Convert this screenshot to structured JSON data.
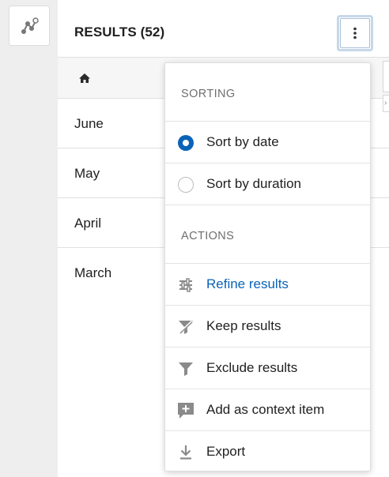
{
  "left_rail": {
    "button_icon": "graph-nodes-icon"
  },
  "header": {
    "title": "RESULTS (52)",
    "menu_icon": "kebab-menu-icon"
  },
  "breadcrumb": {
    "icon": "home-icon"
  },
  "results": [
    {
      "label": "June"
    },
    {
      "label": "May"
    },
    {
      "label": "April"
    },
    {
      "label": "March"
    }
  ],
  "menu": {
    "sorting_heading": "SORTING",
    "sort_options": [
      {
        "label": "Sort by date",
        "selected": true
      },
      {
        "label": "Sort by duration",
        "selected": false
      }
    ],
    "actions_heading": "ACTIONS",
    "actions": [
      {
        "label": "Refine results",
        "icon": "sliders-icon"
      },
      {
        "label": "Keep results",
        "icon": "filter-cross-icon"
      },
      {
        "label": "Exclude results",
        "icon": "filter-icon"
      },
      {
        "label": "Add as context item",
        "icon": "comment-plus-icon"
      },
      {
        "label": "Export",
        "icon": "download-icon"
      }
    ]
  },
  "colors": {
    "accent": "#0b63b6",
    "rail_background": "#eeeeee",
    "muted_text": "#6e6e6e"
  }
}
